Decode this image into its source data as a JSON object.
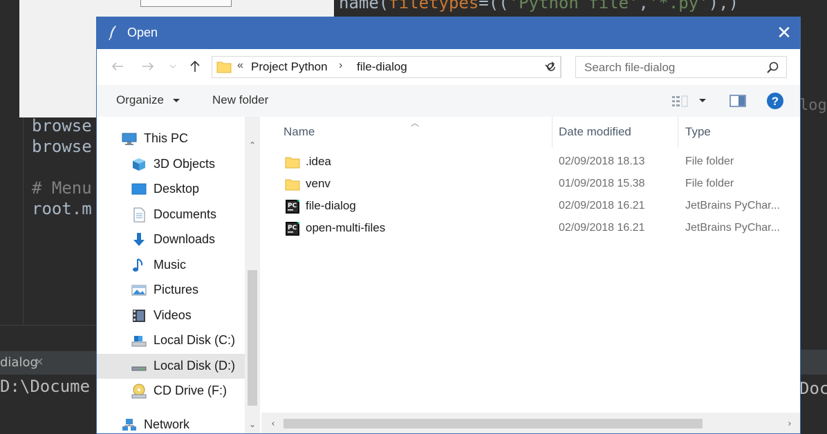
{
  "background": {
    "code_top": [
      "name(",
      "filetypes",
      "=",
      "(",
      "(",
      "'Python file'",
      ",",
      "'*.py'",
      ")",
      ",",
      ")"
    ],
    "code_lines": [
      "browse",
      "browse",
      "# Menu",
      "root.m"
    ],
    "side_right": [
      "log"
    ],
    "tab_label": "dialog",
    "output_left": "D:\\Docume",
    "output_right": "Doc"
  },
  "dialog": {
    "title": "Open",
    "close": "✕"
  },
  "address": {
    "overflow": "«",
    "crumbs": [
      "Project Python",
      "file-dialog"
    ],
    "sep": "›"
  },
  "search": {
    "placeholder": "Search file-dialog"
  },
  "toolbar": {
    "organize": "Organize",
    "new_folder": "New folder"
  },
  "nav": {
    "items": [
      {
        "label": "This PC",
        "icon": "computer-icon"
      },
      {
        "label": "3D Objects",
        "icon": "3d-objects-icon"
      },
      {
        "label": "Desktop",
        "icon": "desktop-icon"
      },
      {
        "label": "Documents",
        "icon": "documents-icon"
      },
      {
        "label": "Downloads",
        "icon": "downloads-icon"
      },
      {
        "label": "Music",
        "icon": "music-icon"
      },
      {
        "label": "Pictures",
        "icon": "pictures-icon"
      },
      {
        "label": "Videos",
        "icon": "videos-icon"
      },
      {
        "label": "Local Disk (C:)",
        "icon": "drive-icon"
      },
      {
        "label": "Local Disk (D:)",
        "icon": "drive-icon",
        "selected": true
      },
      {
        "label": "CD Drive (F:)",
        "icon": "cd-drive-icon"
      },
      {
        "label": "Network",
        "icon": "network-icon"
      }
    ]
  },
  "columns": {
    "name": "Name",
    "date": "Date modified",
    "type": "Type"
  },
  "files": [
    {
      "name": ".idea",
      "date": "02/09/2018 18.13",
      "type": "File folder",
      "icon": "folder-icon"
    },
    {
      "name": "venv",
      "date": "01/09/2018 15.38",
      "type": "File folder",
      "icon": "folder-icon"
    },
    {
      "name": "file-dialog",
      "date": "02/09/2018 16.21",
      "type": "JetBrains PyChar...",
      "icon": "pycharm-file-icon"
    },
    {
      "name": "open-multi-files",
      "date": "02/09/2018 16.21",
      "type": "JetBrains PyChar...",
      "icon": "pycharm-file-icon"
    }
  ],
  "colors": {
    "titlebar": "#3c6cb8",
    "selection": "#e5e5e5",
    "folder": "#ffd96b",
    "help": "#1e6fc5"
  }
}
